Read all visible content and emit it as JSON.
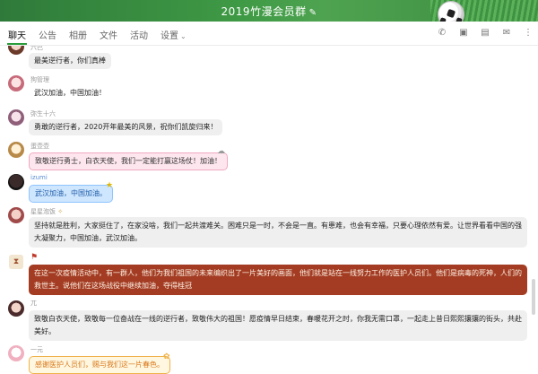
{
  "window": {
    "title": "2019竹漫会员群",
    "edit_icon": "pencil-icon"
  },
  "tabs": [
    {
      "label": "聊天"
    },
    {
      "label": "公告"
    },
    {
      "label": "相册"
    },
    {
      "label": "文件"
    },
    {
      "label": "活动"
    },
    {
      "label": "设置"
    }
  ],
  "toolbar_icons": [
    "phone-icon",
    "video-icon",
    "screen-share-icon",
    "group-icon",
    "more-icon"
  ],
  "accent_color": "#2a9d3c",
  "messages": [
    {
      "nick": "六巴",
      "text": "最美逆行者，你们真棒"
    },
    {
      "nick": "狗管理",
      "text": "武汉加油，中国加油！"
    },
    {
      "nick": "弥生十六",
      "text": "勇敢的逆行者，2020开年最美的风景，祝你们凯旋归来！"
    },
    {
      "nick": "蛋壶壶",
      "text": "致敬逆行勇士，白衣天使，我们一定能打赢这场仗！加油！"
    },
    {
      "nick": "izumi",
      "text": "武汉加油，中国加油。"
    },
    {
      "nick": "星星泡饭",
      "line1": "坚持就是胜利，大家挺住了，在家没啥，我们一起共渡难关。困难只是一时，不会是一直。有患难，也会有幸福，只要心理依然有爱。让世界看看中国的强",
      "line2": "大凝聚力，中国加油，武汉加油。"
    },
    {
      "nick": "",
      "line1": "在这一次疫情活动中，有一群人，他们为我们祖国的未来编织出了一片美好的画面，他们就是站在一线努力工作的医护人员们。他们是病毒的死神，人们的",
      "line2": "救世主。说他们在这场战役中继续加油，夺得桂冠"
    },
    {
      "nick": "兀",
      "line1": "致敬白衣天使，致敬每一位奋战在一线的逆行者，致敬伟大的祖国！愿疫情早日结束，春暖花开之时，你我无需口罩，一起走上昔日熙熙攘攘的街头，共赴",
      "line2": "美好。"
    },
    {
      "nick": "一元",
      "text": "感谢医护人员们，赐与我们这一片春色。"
    }
  ]
}
